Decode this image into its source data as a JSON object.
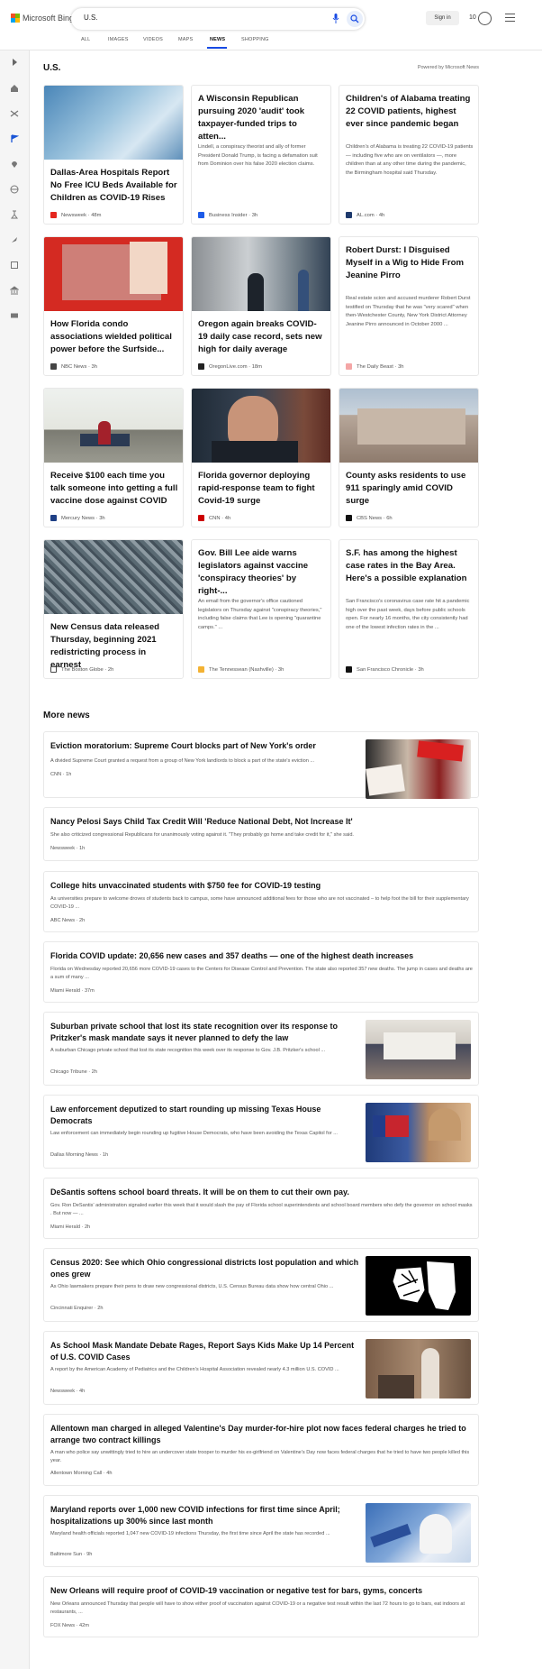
{
  "app": {
    "brand": "Microsoft Bing"
  },
  "search": {
    "query": "U.S."
  },
  "header": {
    "signin": "Sign in",
    "rewards_count": "10"
  },
  "tabs": [
    "ALL",
    "IMAGES",
    "VIDEOS",
    "MAPS",
    "NEWS",
    "SHOPPING"
  ],
  "active_tab": "NEWS",
  "section": {
    "title": "U.S.",
    "powered": "Powered by Microsoft News"
  },
  "cards": [
    {
      "title": "Dallas-Area Hospitals Report No Free ICU Beds Available for Children as COVID-19 Rises",
      "snippet": "",
      "source": "Newsweek",
      "time": "48m"
    },
    {
      "title": "A Wisconsin Republican pursuing 2020 'audit' took taxpayer-funded trips to atten...",
      "snippet": "Lindell, a conspiracy theorist and ally of former President Donald Trump, is facing a defamation suit from Dominion over his false 2020 election claims.",
      "source": "Business Insider",
      "time": "3h"
    },
    {
      "title": "Children's of Alabama treating 22 COVID patients, highest ever since pandemic began",
      "snippet": "Children's of Alabama is treating 22 COVID-19 patients — including five who are on ventilators —, more children than at any other time during the pandemic, the Birmingham hospital said Thursday.",
      "source": "AL.com",
      "time": "4h"
    },
    {
      "title": "How Florida condo associations wielded political power before the Surfside...",
      "snippet": "",
      "source": "NBC News",
      "time": "3h"
    },
    {
      "title": "Oregon again breaks COVID-19 daily case record, sets new high for daily average",
      "snippet": "",
      "source": "OregonLive.com",
      "time": "18m"
    },
    {
      "title": "Robert Durst: I Disguised Myself in a Wig to Hide From Jeanine Pirro",
      "snippet": "Real estate scion and accused murderer Robert Durst testified on Thursday that he was \"very scared\" when then-Westchester County, New York District Attorney Jeanine Pirro announced in October 2000 ...",
      "source": "The Daily Beast",
      "time": "3h"
    },
    {
      "title": "Receive $100 each time you talk someone into getting a full vaccine dose against COVID",
      "snippet": "",
      "source": "Mercury News",
      "time": "3h"
    },
    {
      "title": "Florida governor deploying rapid-response team to fight Covid-19 surge",
      "snippet": "",
      "source": "CNN",
      "time": "4h"
    },
    {
      "title": "County asks residents to use 911 sparingly amid COVID surge",
      "snippet": "",
      "source": "CBS News",
      "time": "6h"
    },
    {
      "title": "New Census data released Thursday, beginning 2021 redistricting process in earnest",
      "snippet": "",
      "source": "The Boston Globe",
      "time": "2h"
    },
    {
      "title": "Gov. Bill Lee aide warns legislators against vaccine 'conspiracy theories' by right-...",
      "snippet": "An email from the governor's office cautioned legislators on Thursday against \"conspiracy theories,\" including false claims that Lee is opening \"quarantine camps.\" ...",
      "source": "The Tennessean (Nashville)",
      "time": "3h"
    },
    {
      "title": "S.F. has among the highest case rates in the Bay Area. Here's a possible explanation",
      "snippet": "San Francisco's coronavirus case rate hit a pandemic high over the past week, days before public schools open. For nearly 16 months, the city consistently had one of the lowest infection rates in the ...",
      "source": "San Francisco Chronicle",
      "time": "3h"
    }
  ],
  "more_news_title": "More news",
  "more_news": [
    {
      "title": "Eviction moratorium: Supreme Court blocks part of New York's order",
      "snippet": "A divided Supreme Court granted a request from a group of New York landlords to block a part of the state's eviction ...",
      "source": "CNN",
      "time": "1h"
    },
    {
      "title": "Nancy Pelosi Says Child Tax Credit Will 'Reduce National Debt, Not Increase It'",
      "snippet": "She also criticized congressional Republicans for unanimously voting against it. \"They probably go home and take credit for it,\" she said.",
      "source": "Newsweek",
      "time": "1h"
    },
    {
      "title": "College hits unvaccinated students with $750 fee for COVID-19 testing",
      "snippet": "As universities prepare to welcome droves of students back to campus, some have announced additional fees for those who are not vaccinated – to help foot the bill for their supplementary COVID-19 ...",
      "source": "ABC News",
      "time": "2h"
    },
    {
      "title": "Florida COVID update: 20,656 new cases and 357 deaths — one of the highest death increases",
      "snippet": "Florida on Wednesday reported 20,656 more COVID-19 cases to the Centers for Disease Control and Prevention. The state also reported 357 new deaths. The jump in cases and deaths are a sum of many ...",
      "source": "Miami Herald",
      "time": "37m"
    },
    {
      "title": "Suburban private school that lost its state recognition over its response to Pritzker's mask mandate says it never planned to defy the law",
      "snippet": "A suburban Chicago private school that lost its state recognition this week over its response to Gov. J.B. Pritzker's school ...",
      "source": "Chicago Tribune",
      "time": "2h"
    },
    {
      "title": "Law enforcement deputized to start rounding up missing Texas House Democrats",
      "snippet": "Law enforcement can immediately begin rounding up fugitive House Democrats, who have been avoiding the Texas Capitol for ...",
      "source": "Dallas Morning News",
      "time": "1h"
    },
    {
      "title": "DeSantis softens school board threats. It will be on them to cut their own pay.",
      "snippet": "Gov. Ron DeSantis' administration signaled earlier this week that it would slash the pay of Florida school superintendents and school board members who defy the governor on school masks . But now — ...",
      "source": "Miami Herald",
      "time": "2h"
    },
    {
      "title": "Census 2020: See which Ohio congressional districts lost population and which ones grew",
      "snippet": "As Ohio lawmakers prepare their pens to draw new congressional districts, U.S. Census Bureau data show how central Ohio ...",
      "source": "Cincinnati Enquirer",
      "time": "2h"
    },
    {
      "title": "As School Mask Mandate Debate Rages, Report Says Kids Make Up 14 Percent of U.S. COVID Cases",
      "snippet": "A report by the American Academy of Pediatrics and the Children's Hospital Association revealed nearly 4.3 million U.S. COVID ...",
      "source": "Newsweek",
      "time": "4h"
    },
    {
      "title": "Allentown man charged in alleged Valentine's Day murder-for-hire plot now faces federal charges he tried to arrange two contract killings",
      "snippet": "A man who police say unwittingly tried to hire an undercover state trooper to murder his ex-girlfriend on Valentine's Day now faces federal charges that he tried to have two people killed this year.",
      "source": "Allentown Morning Call",
      "time": "4h"
    },
    {
      "title": "Maryland reports over 1,000 new COVID infections for first time since April; hospitalizations up 300% since last month",
      "snippet": "Maryland health officials reported 1,047 new COVID-19 infections Thursday, the first time since April the state has recorded ...",
      "source": "Baltimore Sun",
      "time": "9h"
    },
    {
      "title": "New Orleans will require proof of COVID-19 vaccination or negative test for bars, gyms, concerts",
      "snippet": "New Orleans announced Thursday that people will have to show either proof of vaccination against COVID-19 or a negative test result within the last 72 hours to go to bars, eat indoors at restaurants, ...",
      "source": "FOX News",
      "time": "42m"
    }
  ],
  "colors": {
    "accent": "#174ae4"
  }
}
